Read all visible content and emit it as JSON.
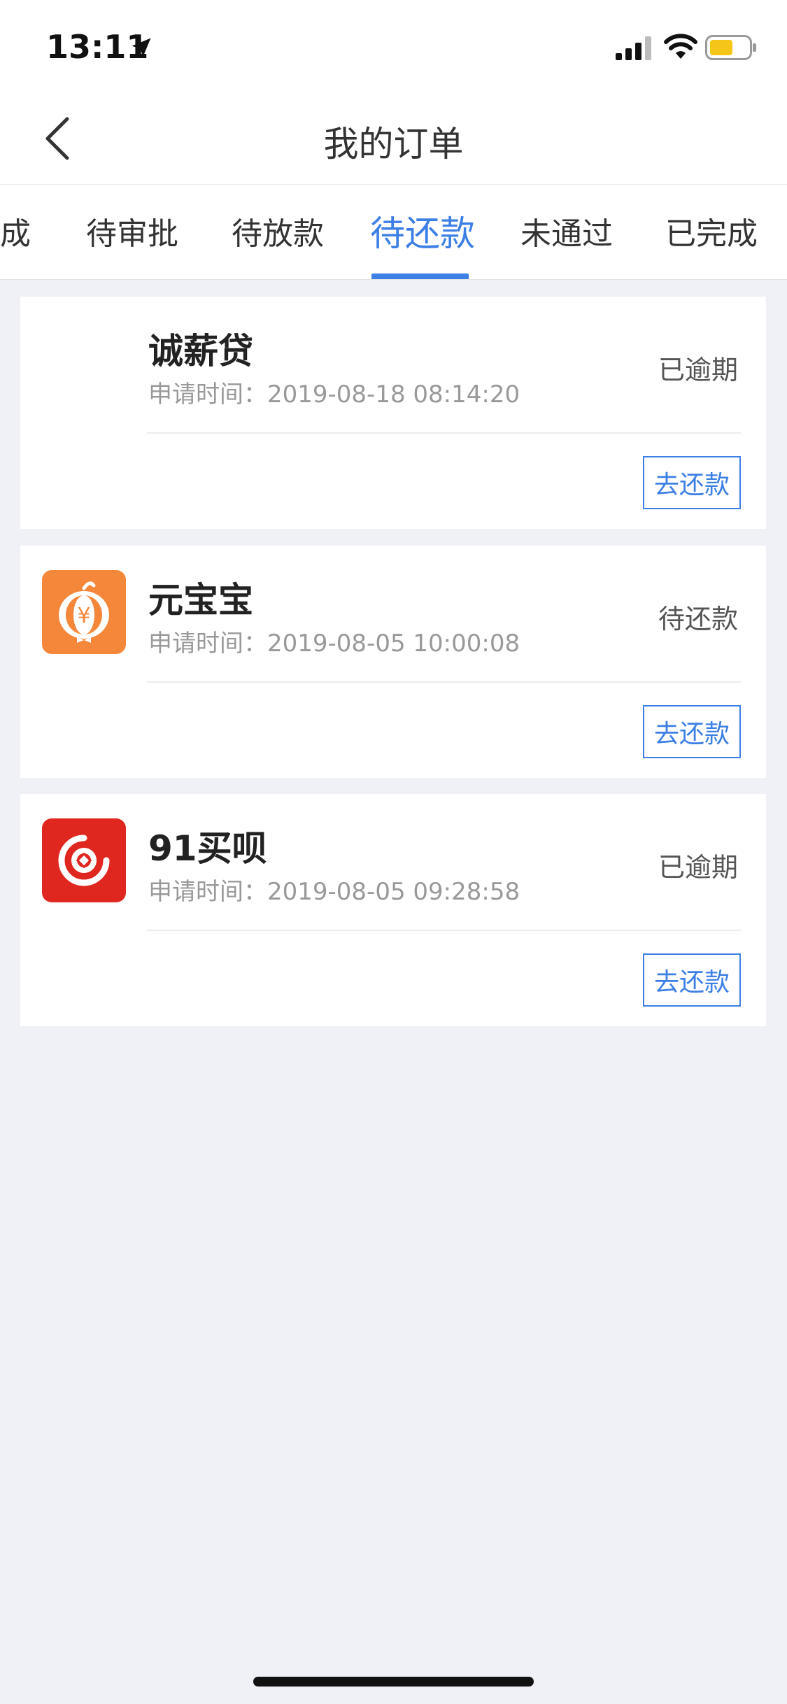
{
  "status_bar": {
    "time": "13:11",
    "battery_color": "#f5c518",
    "icons": [
      "location-arrow-icon",
      "signal-icon",
      "wifi-icon",
      "battery-icon"
    ]
  },
  "nav": {
    "title": "我的订单",
    "back_icon": "chevron-left-icon"
  },
  "tabs": {
    "items": [
      "成",
      "待审批",
      "待放款",
      "待还款",
      "未通过",
      "已完成"
    ],
    "active_index": 3,
    "accent": "#3c7fe5"
  },
  "orders": [
    {
      "name": "诚薪贷",
      "time_label": "申请时间：",
      "time": "2019-08-18 08:14:20",
      "status": "已逾期",
      "action": "去还款",
      "logo": "none"
    },
    {
      "name": "元宝宝",
      "time_label": "申请时间：",
      "time": "2019-08-05 10:00:08",
      "status": "待还款",
      "action": "去还款",
      "logo": "yuanbaobao-logo-icon",
      "logo_color": "#f5873a"
    },
    {
      "name": "91买呗",
      "time_label": "申请时间：",
      "time": "2019-08-05 09:28:58",
      "status": "已逾期",
      "action": "去还款",
      "logo": "91maibei-logo-icon",
      "logo_color": "#e0271f"
    }
  ]
}
